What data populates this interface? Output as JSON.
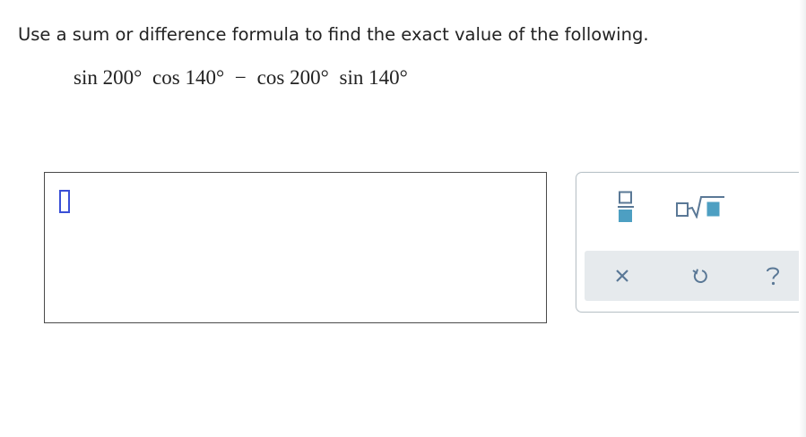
{
  "question": {
    "instructions": "Use a sum or difference formula to find the exact value of the following.",
    "expression": {
      "term1_func": "sin",
      "term1_angle": "200°",
      "term2_func": "cos",
      "term2_angle": "140°",
      "operator": "−",
      "term3_func": "cos",
      "term3_angle": "200°",
      "term4_func": "sin",
      "term4_angle": "140°"
    }
  },
  "answer": {
    "value": ""
  },
  "palette": {
    "tools": [
      "fraction-icon",
      "radical-icon"
    ],
    "actions": [
      "clear-icon",
      "undo-icon",
      "help-icon"
    ],
    "colors": {
      "icon": "#5a7896",
      "fill": "#4d9fc2",
      "cursor": "#3a4fd6",
      "action_bar": "#e6eaed"
    }
  }
}
